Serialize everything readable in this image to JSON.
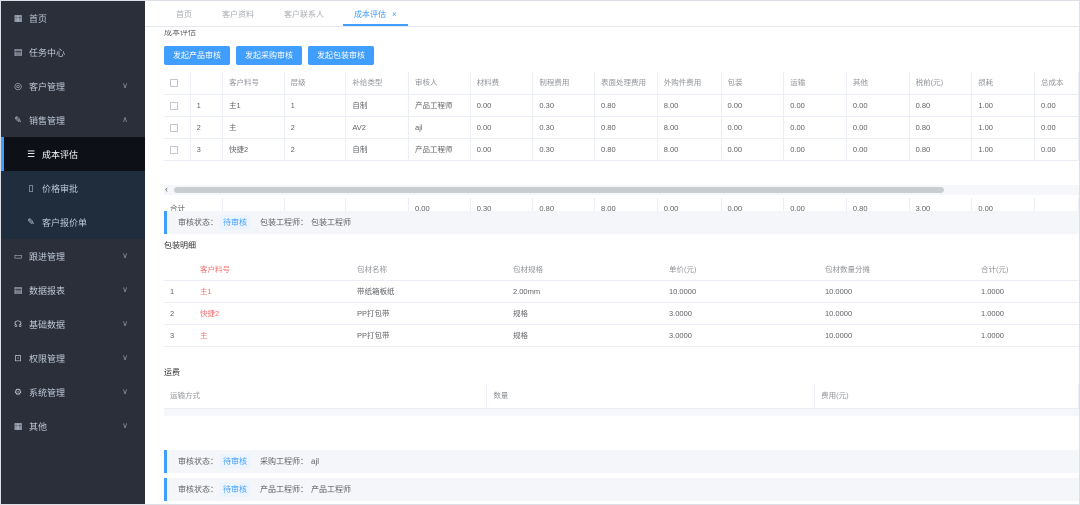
{
  "sidebar": {
    "items": [
      {
        "icon": "grid-icon",
        "glyph": "▦",
        "label": "首页"
      },
      {
        "icon": "document-icon",
        "glyph": "▤",
        "label": "任务中心"
      },
      {
        "icon": "handshake-icon",
        "glyph": "◎",
        "label": "客户管理"
      },
      {
        "icon": "wrench-icon",
        "glyph": "✎",
        "label": "销售管理"
      },
      {
        "icon": "list-icon",
        "glyph": "☰",
        "label": "成本评估"
      },
      {
        "icon": "file-icon",
        "glyph": "▯",
        "label": "价格审批"
      },
      {
        "icon": "wrench-icon",
        "glyph": "✎",
        "label": "客户报价单"
      },
      {
        "icon": "chat-icon",
        "glyph": "▭",
        "label": "跟进管理"
      },
      {
        "icon": "report-icon",
        "glyph": "▤",
        "label": "数据报表"
      },
      {
        "icon": "headset-icon",
        "glyph": "☊",
        "label": "基础数据"
      },
      {
        "icon": "lock-icon",
        "glyph": "⊡",
        "label": "权限管理"
      },
      {
        "icon": "gear-icon",
        "glyph": "⚙",
        "label": "系统管理"
      },
      {
        "icon": "box-icon",
        "glyph": "▦",
        "label": "其他"
      }
    ]
  },
  "tabs": [
    {
      "label": "首页"
    },
    {
      "label": "客户资料"
    },
    {
      "label": "客户联系人"
    },
    {
      "label": "成本评估"
    }
  ],
  "cut_title": "成本评估",
  "buttons": {
    "product": "发起产品审核",
    "purchase": "发起采购审核",
    "packaging": "发起包装审核"
  },
  "cost_table": {
    "headers": [
      "客户料号",
      "层级",
      "补给类型",
      "审核人",
      "材料费",
      "制程费用",
      "表面处理费用",
      "外购件费用",
      "包装",
      "运输",
      "其他",
      "税前(元)",
      "损耗",
      "总成本"
    ],
    "rows": [
      [
        "1",
        "主1",
        "1",
        "自制",
        "产品工程师",
        "0.00",
        "0.30",
        "0.80",
        "8.00",
        "0.00",
        "0.00",
        "0.00",
        "0.80",
        "1.00",
        "0.00"
      ],
      [
        "2",
        "主",
        "2",
        "AV2",
        "ajl",
        "0.00",
        "0.30",
        "0.80",
        "8.00",
        "0.00",
        "0.00",
        "0.00",
        "0.80",
        "1.00",
        "0.00"
      ],
      [
        "3",
        "快捷2",
        "2",
        "自制",
        "产品工程师",
        "0.00",
        "0.30",
        "0.80",
        "8.00",
        "0.00",
        "0.00",
        "0.00",
        "0.80",
        "1.00",
        "0.00"
      ]
    ],
    "sum_label": "合计",
    "sums": [
      "0.00",
      "0.30",
      "0.80",
      "8.00",
      "0.00",
      "0.00",
      "0.00",
      "0.80",
      "3.00",
      "0.00"
    ]
  },
  "status_1": {
    "label": "审核状态：",
    "badge": "待审核",
    "role": "包装工程师：",
    "person": "包装工程师"
  },
  "packaging": {
    "title": "包装明细",
    "headers": [
      "客户料号",
      "包材名称",
      "包材规格",
      "单价(元)",
      "包材数量分摊",
      "合计(元)"
    ],
    "rows": [
      [
        "1",
        "主1",
        "带纸箱板纸",
        "2.00mm",
        "10.0000",
        "10.0000",
        "1.0000"
      ],
      [
        "2",
        "快捷2",
        "PP打包带",
        "规格",
        "3.0000",
        "10.0000",
        "1.0000"
      ],
      [
        "3",
        "主",
        "PP打包带",
        "规格",
        "3.0000",
        "10.0000",
        "1.0000"
      ]
    ]
  },
  "transport": {
    "title": "运费",
    "headers": [
      "运输方式",
      "数量",
      "费用(元)"
    ]
  },
  "status_2": {
    "label": "审核状态：",
    "badge": "待审核",
    "role": "采购工程师：",
    "person": "ajl"
  },
  "status_3": {
    "label": "审核状态：",
    "badge": "待审核",
    "role": "产品工程师：",
    "person": "产品工程师"
  }
}
